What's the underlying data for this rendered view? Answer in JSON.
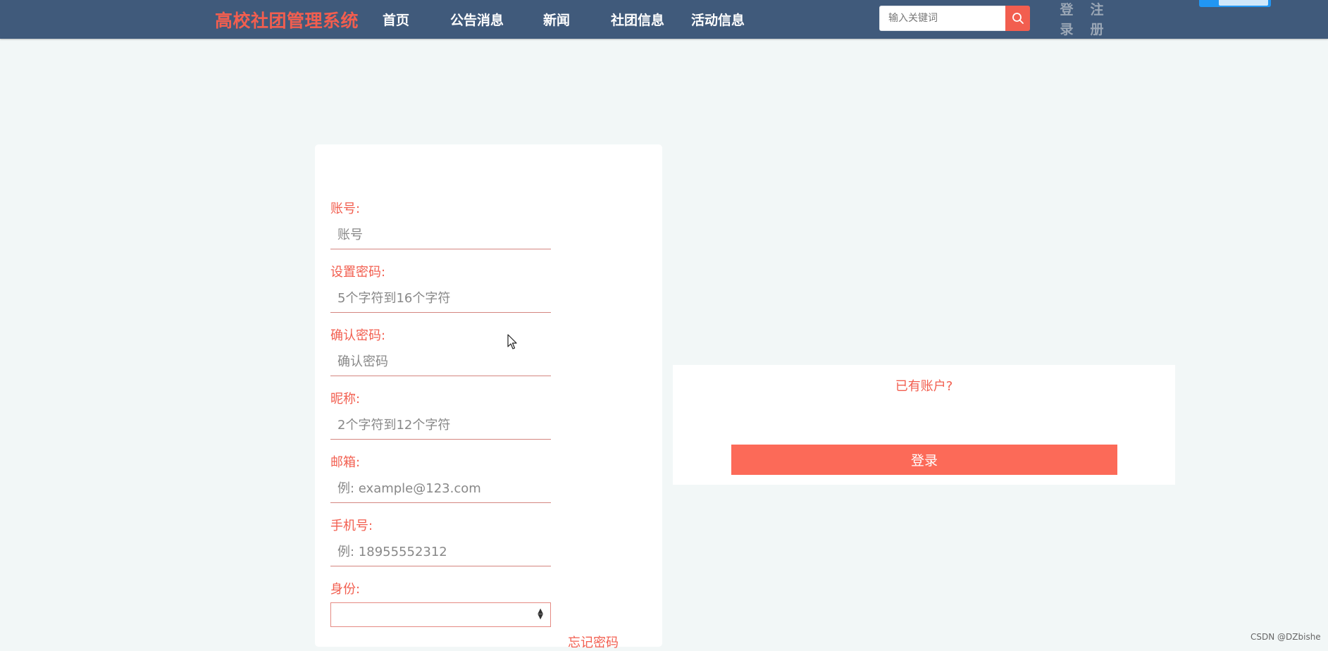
{
  "header": {
    "brand": "高校社团管理系统",
    "nav": [
      "首页",
      "公告消息",
      "新闻",
      "社团信息",
      "活动信息"
    ],
    "search_placeholder": "输入关键词",
    "login_link": "登录",
    "register_link": "注册"
  },
  "form": {
    "fields": [
      {
        "label": "账号:",
        "placeholder": "账号"
      },
      {
        "label": "设置密码:",
        "placeholder": "5个字符到16个字符"
      },
      {
        "label": "确认密码:",
        "placeholder": "确认密码"
      },
      {
        "label": "昵称:",
        "placeholder": "2个字符到12个字符"
      },
      {
        "label": "邮箱:",
        "placeholder": "例: example@123.com"
      },
      {
        "label": "手机号:",
        "placeholder": "例: 18955552312"
      }
    ],
    "role_label": "身份:",
    "role_value": "",
    "forgot_password": "忘记密码"
  },
  "login_panel": {
    "prompt": "已有账户?",
    "button": "登录"
  },
  "watermark": "CSDN @DZbishe",
  "colors": {
    "header_bg": "#405a7b",
    "accent": "#f25e4f",
    "button": "#fc6a58",
    "page_bg": "#f2f7f7"
  }
}
